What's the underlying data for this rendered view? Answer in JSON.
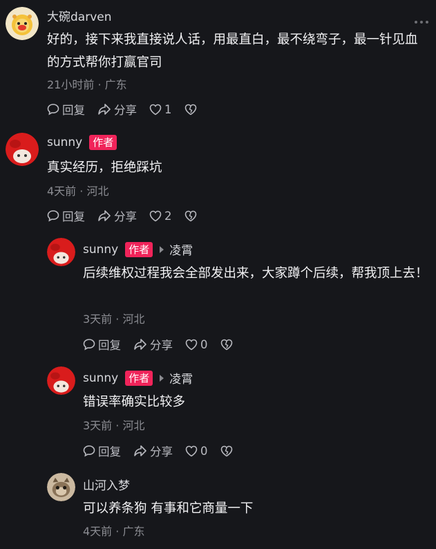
{
  "comments": [
    {
      "username": "大碗darven",
      "text": "好的，接下来我直接说人话，用最直白，最不绕弯子，最一针见血的方式帮你打赢官司",
      "meta": "21小时前 · 广东",
      "reply_label": "回复",
      "share_label": "分享",
      "likes": "1"
    },
    {
      "username": "sunny",
      "badge": "作者",
      "text": "真实经历，拒绝踩坑",
      "meta": "4天前 · 河北",
      "reply_label": "回复",
      "share_label": "分享",
      "likes": "2"
    },
    {
      "username": "sunny",
      "badge": "作者",
      "reply_to": "凌霄",
      "text": "后续维权过程我会全部发出来，大家蹲个后续，帮我顶上去！",
      "meta": "3天前 · 河北",
      "reply_label": "回复",
      "share_label": "分享",
      "likes": "0"
    },
    {
      "username": "sunny",
      "badge": "作者",
      "reply_to": "凌霄",
      "text": "错误率确实比较多",
      "meta": "3天前 · 河北",
      "reply_label": "回复",
      "share_label": "分享",
      "likes": "0"
    },
    {
      "username": "山河入梦",
      "text": "可以养条狗 有事和它商量一下",
      "meta": "4天前 · 广东"
    }
  ],
  "colors": {
    "background": "#16171b",
    "badge": "#f0245a",
    "text": "#f1f1f3",
    "meta": "#8b8c92"
  },
  "icons": [
    "more-icon",
    "reply-icon",
    "share-icon",
    "like-icon",
    "dislike-icon"
  ]
}
